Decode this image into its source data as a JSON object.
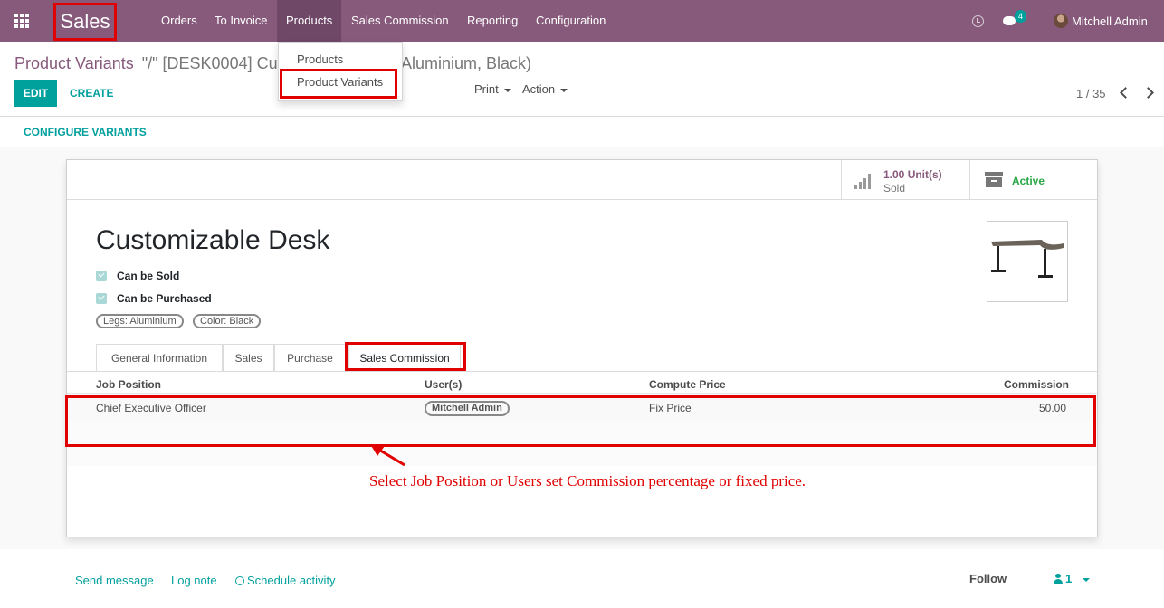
{
  "navbar": {
    "app_name": "Sales",
    "menu": [
      "Orders",
      "To Invoice",
      "Products",
      "Sales Commission",
      "Reporting",
      "Configuration"
    ],
    "active_menu": "Products",
    "messages_badge": "4",
    "user_name": "Mitchell Admin",
    "colors": {
      "navbar": "#875a7b",
      "accent": "#00a09d",
      "highlight": "#e00000"
    }
  },
  "products_dropdown": {
    "items": [
      "Products",
      "Product Variants"
    ],
    "highlighted": "Product Variants"
  },
  "control_panel": {
    "breadcrumb_parent": "Product Variants",
    "breadcrumb_current_left": "\"/\" [DESK0004] Cus",
    "breadcrumb_current_right": "Aluminium, Black)",
    "edit_label": "EDIT",
    "create_label": "CREATE",
    "print_label": "Print",
    "action_label": "Action",
    "pager": "1 / 35",
    "configure_variants_label": "CONFIGURE VARIANTS"
  },
  "stat_buttons": {
    "sold_value": "1.00 Unit(s)",
    "sold_label": "Sold",
    "active_label": "Active"
  },
  "product": {
    "name": "Customizable Desk",
    "can_be_sold_label": "Can be Sold",
    "can_be_sold": true,
    "can_be_purchased_label": "Can be Purchased",
    "can_be_purchased": true,
    "attribute_tags": [
      "Legs: Aluminium",
      "Color: Black"
    ]
  },
  "tabs": [
    "General Information",
    "Sales",
    "Purchase",
    "Sales Commission"
  ],
  "active_tab": "Sales Commission",
  "commission_table": {
    "headers": [
      "Job Position",
      "User(s)",
      "Compute Price",
      "Commission"
    ],
    "rows": [
      {
        "job_position": "Chief Executive Officer",
        "user": "Mitchell Admin",
        "compute_price": "Fix Price",
        "commission": "50.00"
      }
    ]
  },
  "annotation_text": "Select Job Position or Users set Commission percentage or fixed price.",
  "chatter": {
    "send_message": "Send message",
    "log_note": "Log note",
    "schedule_activity": "Schedule activity",
    "follow": "Follow",
    "followers_count": "1"
  }
}
